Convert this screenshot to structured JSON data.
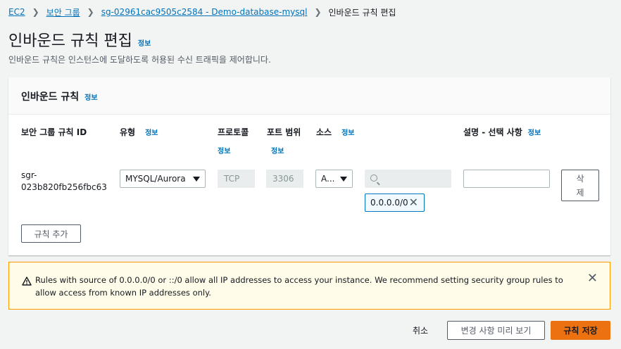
{
  "breadcrumb": {
    "items": [
      "EC2",
      "보안 그룹",
      "sg-02961cac9505c2584 - Demo-database-mysql"
    ],
    "current": "인바운드 규칙 편집"
  },
  "page": {
    "title": "인바운드 규칙 편집",
    "info": "정보",
    "subtitle": "인바운드 규칙은 인스턴스에 도달하도록 허용된 수신 트래픽을 제어합니다."
  },
  "panel": {
    "title": "인바운드 규칙",
    "info": "정보",
    "columns": {
      "rule_id": "보안 그룹 규칙 ID",
      "type": "유형",
      "type_info": "정보",
      "protocol": "프로토콜",
      "protocol_info": "정보",
      "port": "포트 범위",
      "port_info": "정보",
      "source": "소스",
      "source_info": "정보",
      "desc": "설명 - 선택 사항",
      "desc_info": "정보"
    },
    "row": {
      "rule_id_line1": "sgr-",
      "rule_id_line2": "023b820fb256fbc63",
      "type_value": "MYSQL/Aurora",
      "protocol_value": "TCP",
      "port_value": "3306",
      "source_value": "A...",
      "search_placeholder": "",
      "token": "0.0.0.0/0",
      "description_value": "",
      "delete_line1": "삭",
      "delete_line2": "제"
    },
    "add_rule": "규칙 추가"
  },
  "warning": {
    "text": "Rules with source of 0.0.0.0/0 or ::/0 allow all IP addresses to access your instance. We recommend setting security group rules to allow access from known IP addresses only."
  },
  "footer": {
    "cancel": "취소",
    "preview": "변경 사항 미리 보기",
    "save": "규칙 저장"
  },
  "colors": {
    "link": "#0073bb",
    "primary_button": "#ec7211",
    "warning_border": "#ff9900",
    "warning_bg": "#fffce9"
  },
  "icons": {
    "breadcrumb_separator": "chevron-right-icon",
    "warning": "warning-icon",
    "close": "close-icon",
    "search": "search-icon",
    "dropdown": "caret-down-icon"
  }
}
